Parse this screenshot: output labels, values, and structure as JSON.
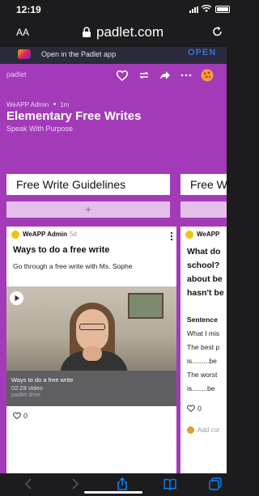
{
  "status": {
    "time": "12:19"
  },
  "browser": {
    "text_size_label": "AA",
    "domain": "padlet.com"
  },
  "app_banner": {
    "text": "Open in the Padlet app",
    "open_label": "OPEN"
  },
  "padlet": {
    "logo": "padlet",
    "author": "WeAPP Admin",
    "posted": "1m",
    "title": "Elementary Free Writes",
    "subtitle": "Speak With Purpose"
  },
  "columns": [
    {
      "title": "Free Write Guidelines",
      "add_label": "+",
      "post": {
        "author": "WeAPP Admin",
        "time": "5d",
        "title": "Ways to do a free write",
        "body": "Go through a free write with Ms. Sophe",
        "video": {
          "caption_title": "Ways to do a free write",
          "caption_meta": "02:28 video",
          "caption_source": "padlet drive"
        },
        "likes": "0"
      }
    },
    {
      "title": "Free W",
      "add_label": "",
      "post": {
        "author": "WeAPP",
        "title": "What do\nschool? \nabout be\nhasn't be",
        "sentence_label": "Sentence",
        "lines": [
          "What I mis",
          "The best p",
          "is.........be",
          "The worst",
          "is........be"
        ],
        "likes": "0",
        "comment_placeholder": "Add cor"
      }
    }
  ],
  "colors": {
    "board": "#a33bb8",
    "add_bar": "#e4bfe9",
    "safari_blue": "#0a84ff"
  }
}
